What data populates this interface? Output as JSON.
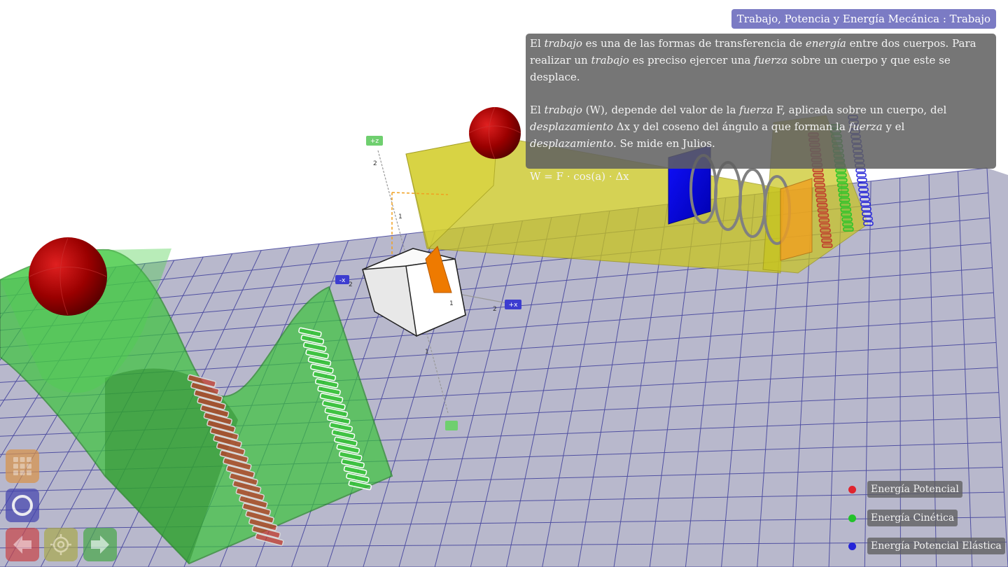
{
  "header": {
    "title": "Trabajo, Potencia y Energía Mecánica : Trabajo"
  },
  "info_panel": {
    "p1": [
      {
        "text": "El ",
        "em": false
      },
      {
        "text": "trabajo",
        "em": true
      },
      {
        "text": " es una de las formas de transferencia de ",
        "em": false
      },
      {
        "text": "energía",
        "em": true
      },
      {
        "text": " entre dos cuerpos. Para realizar un ",
        "em": false
      },
      {
        "text": "trabajo",
        "em": true
      },
      {
        "text": " es preciso ejercer una ",
        "em": false
      },
      {
        "text": "fuerza",
        "em": true
      },
      {
        "text": " sobre un cuerpo y que este se desplace.",
        "em": false
      }
    ],
    "p2": [
      {
        "text": "El ",
        "em": false
      },
      {
        "text": "trabajo",
        "em": true
      },
      {
        "text": " (W), depende del valor de la ",
        "em": false
      },
      {
        "text": "fuerza",
        "em": true
      },
      {
        "text": " F, aplicada sobre un cuerpo, del ",
        "em": false
      },
      {
        "text": "desplazamiento",
        "em": true
      },
      {
        "text": " Δx y del coseno del ángulo a que forman la ",
        "em": false
      },
      {
        "text": "fuerza",
        "em": true
      },
      {
        "text": " y el ",
        "em": false
      },
      {
        "text": "desplazamiento",
        "em": true
      },
      {
        "text": ". Se mide en Julios.",
        "em": false
      }
    ],
    "formula": "W = F · cos(a) · Δx"
  },
  "legend": [
    {
      "label": "Energía Potencial",
      "color": "#e0242f"
    },
    {
      "label": "Energía Cinética",
      "color": "#22c22a"
    },
    {
      "label": "Energía Potencial Elástica",
      "color": "#2424d8"
    }
  ],
  "axes": {
    "z_label": "+z",
    "x_label": "+x",
    "neg_x_label": "-x",
    "ticks": [
      "2",
      "1",
      "1",
      "2",
      "1",
      "2"
    ]
  },
  "controls": [
    {
      "name": "grid-menu",
      "icon": "grid-icon",
      "color": "#d9944a"
    },
    {
      "name": "record",
      "icon": "circle-icon",
      "color": "#4646b0"
    },
    {
      "name": "back",
      "icon": "arrow-left-icon",
      "color": "#c8474a"
    },
    {
      "name": "center",
      "icon": "crosshair-icon",
      "color": "#a9a950"
    },
    {
      "name": "forward",
      "icon": "arrow-right-icon",
      "color": "#4aa84a"
    }
  ],
  "colors": {
    "floor": "#b8b8cc",
    "grid": "#3e3e9a",
    "green_shape": "#3cc43c",
    "yellow_shape": "#c8c41c",
    "ball": "#b00000",
    "potential_bar": "#c0392b",
    "kinetic_bar": "#27c427",
    "elastic_bar": "#2424d8"
  }
}
